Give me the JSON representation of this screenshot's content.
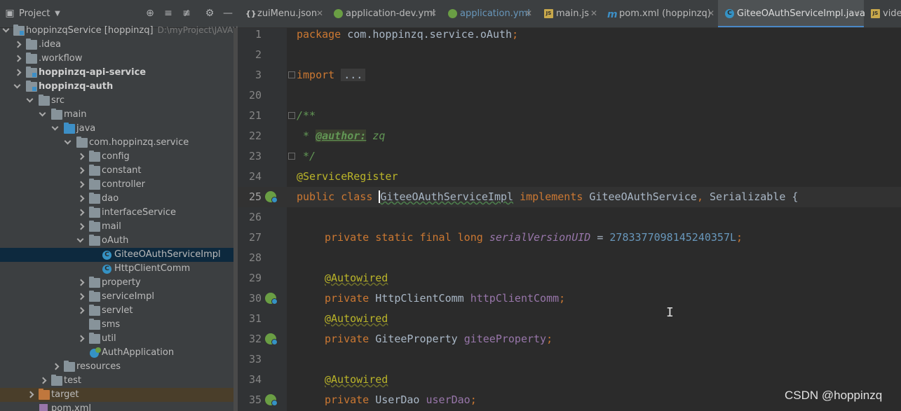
{
  "project_panel": {
    "title": "Project",
    "root": {
      "label": "hoppinzqService [hoppinzq]",
      "path": "D:\\myProject\\JAVA\\ho"
    },
    "items": [
      {
        "label": ".idea"
      },
      {
        "label": ".workflow"
      },
      {
        "label": "hoppinzq-api-service"
      },
      {
        "label": "hoppinzq-auth"
      },
      {
        "label": "src"
      },
      {
        "label": "main"
      },
      {
        "label": "java"
      },
      {
        "label": "com.hoppinzq.service"
      },
      {
        "label": "config"
      },
      {
        "label": "constant"
      },
      {
        "label": "controller"
      },
      {
        "label": "dao"
      },
      {
        "label": "interfaceService"
      },
      {
        "label": "mail"
      },
      {
        "label": "oAuth"
      },
      {
        "label": "GiteeOAuthServiceImpl"
      },
      {
        "label": "HttpClientComm"
      },
      {
        "label": "property"
      },
      {
        "label": "serviceImpl"
      },
      {
        "label": "servlet"
      },
      {
        "label": "sms"
      },
      {
        "label": "util"
      },
      {
        "label": "AuthApplication"
      },
      {
        "label": "resources"
      },
      {
        "label": "test"
      },
      {
        "label": "target"
      },
      {
        "label": "pom.xml"
      }
    ]
  },
  "tabs": [
    {
      "label": "zuiMenu.json"
    },
    {
      "label": "application-dev.yml"
    },
    {
      "label": "application.yml"
    },
    {
      "label": "main.js"
    },
    {
      "label": "pom.xml (hoppinzq)"
    },
    {
      "label": "GiteeOAuthServiceImpl.java"
    },
    {
      "label": "vide"
    }
  ],
  "editor": {
    "line_numbers": [
      "1",
      "2",
      "3",
      "20",
      "21",
      "22",
      "23",
      "24",
      "25",
      "26",
      "27",
      "28",
      "29",
      "30",
      "31",
      "32",
      "33",
      "34",
      "35"
    ],
    "current_line": "25",
    "code": {
      "l1_kw": "package",
      "l1_rest": " com.hoppinzq.service.oAuth",
      "l1_semi": ";",
      "l3_kw": "import",
      "l3_fold": "...",
      "l21": "/**",
      "l22_star": " * ",
      "l22_tag": "@author:",
      "l22_val": " zq",
      "l23": " */",
      "l24": "@ServiceRegister",
      "l25_kw1": "public",
      "l25_kw2": "class",
      "l25_cls": "GiteeOAuthServiceImpl",
      "l25_kw3": "implements",
      "l25_if1": " GiteeOAuthService",
      "l25_comma": ",",
      "l25_if2": " Serializable {",
      "l27_kw": "private static final long",
      "l27_fld": "serialVersionUID",
      "l27_eq": " = ",
      "l27_num": "2783377098145240357L",
      "l27_semi": ";",
      "l29": "@Autowired",
      "l30_kw": "private",
      "l30_type": " HttpClientComm ",
      "l30_fld": "httpClientComm",
      "l30_semi": ";",
      "l31": "@Autowired",
      "l32_kw": "private",
      "l32_type": " GiteeProperty ",
      "l32_fld": "giteeProperty",
      "l32_semi": ";",
      "l34": "@Autowired",
      "l35_kw": "private",
      "l35_type": " UserDao ",
      "l35_fld": "userDao",
      "l35_semi": ";"
    }
  },
  "watermark": "CSDN @hoppinzq",
  "colors": {
    "keyword": "#cc7832",
    "annotation": "#bbb529",
    "comment": "#629755",
    "field": "#9876aa",
    "number": "#6897bb",
    "text": "#a9b7c6",
    "selection": "#0d293e",
    "accent": "#4a88c7"
  }
}
